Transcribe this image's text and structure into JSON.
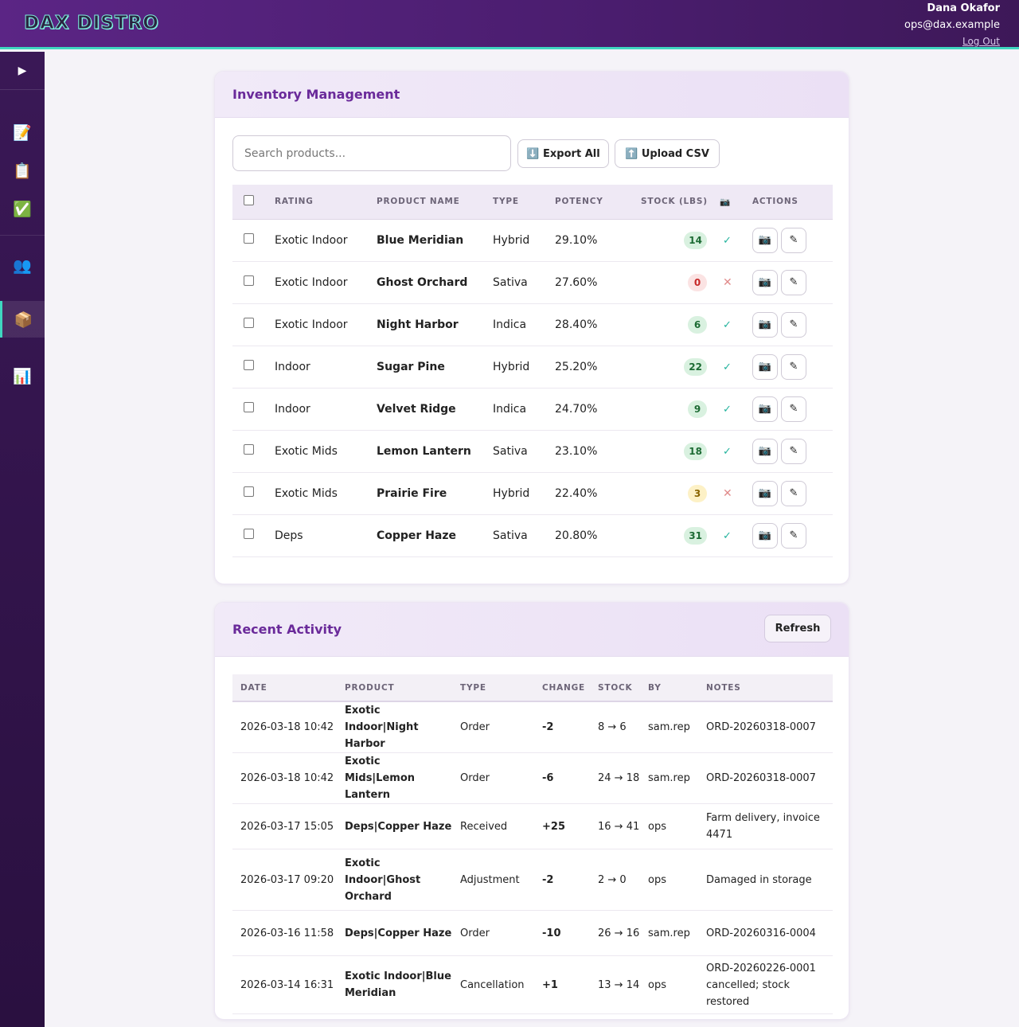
{
  "header": {
    "logo": "DAX DISTRO",
    "user_name": "Dana Okafor",
    "user_email": "ops@dax.example",
    "logout": "Log Out"
  },
  "sidebar": {
    "toggle": "▶",
    "items": [
      {
        "icon": "📝",
        "name": "memo-icon"
      },
      {
        "icon": "📋",
        "name": "clipboard-icon"
      },
      {
        "icon": "✅",
        "name": "checkmark-icon"
      },
      {
        "icon": "👥",
        "name": "users-icon"
      },
      {
        "icon": "📦",
        "name": "package-icon"
      },
      {
        "icon": "📊",
        "name": "chart-icon"
      }
    ]
  },
  "inventory": {
    "title": "Inventory Management",
    "search_placeholder": "Search products...",
    "export_label": "⬇️ Export All",
    "upload_label": "⬆️ Upload CSV",
    "columns": [
      "Rating",
      "Product Name",
      "Type",
      "Potency",
      "Stock (lbs)",
      "📷",
      "Actions"
    ],
    "rows": [
      {
        "rating": "Exotic Indoor",
        "name": "Blue Meridian",
        "type": "Hybrid",
        "potency": "29.10%",
        "stock": "14",
        "stock_level": "green",
        "photo": "✓"
      },
      {
        "rating": "Exotic Indoor",
        "name": "Ghost Orchard",
        "type": "Sativa",
        "potency": "27.60%",
        "stock": "0",
        "stock_level": "red",
        "photo": "✕"
      },
      {
        "rating": "Exotic Indoor",
        "name": "Night Harbor",
        "type": "Indica",
        "potency": "28.40%",
        "stock": "6",
        "stock_level": "green",
        "photo": "✓"
      },
      {
        "rating": "Indoor",
        "name": "Sugar Pine",
        "type": "Hybrid",
        "potency": "25.20%",
        "stock": "22",
        "stock_level": "green",
        "photo": "✓"
      },
      {
        "rating": "Indoor",
        "name": "Velvet Ridge",
        "type": "Indica",
        "potency": "24.70%",
        "stock": "9",
        "stock_level": "green",
        "photo": "✓"
      },
      {
        "rating": "Exotic Mids",
        "name": "Lemon Lantern",
        "type": "Sativa",
        "potency": "23.10%",
        "stock": "18",
        "stock_level": "green",
        "photo": "✓"
      },
      {
        "rating": "Exotic Mids",
        "name": "Prairie Fire",
        "type": "Hybrid",
        "potency": "22.40%",
        "stock": "3",
        "stock_level": "amber",
        "photo": "✕"
      },
      {
        "rating": "Deps",
        "name": "Copper Haze",
        "type": "Sativa",
        "potency": "20.80%",
        "stock": "31",
        "stock_level": "green",
        "photo": "✓"
      }
    ],
    "photo_button_icon": "📷",
    "edit_button_icon": "✎"
  },
  "activity": {
    "title": "Recent Activity",
    "refresh_label": "Refresh",
    "columns": [
      "Date",
      "Product",
      "Type",
      "Change",
      "Stock",
      "By",
      "Notes"
    ],
    "rows": [
      {
        "date": "2026-03-18 10:42",
        "product": "Exotic Indoor|Night Harbor",
        "type": "Order",
        "change": "-2",
        "stock": "8 → 6",
        "by": "sam.rep",
        "notes": "ORD-20260318-0007"
      },
      {
        "date": "2026-03-18 10:42",
        "product": "Exotic Mids|Lemon Lantern",
        "type": "Order",
        "change": "-6",
        "stock": "24 → 18",
        "by": "sam.rep",
        "notes": "ORD-20260318-0007"
      },
      {
        "date": "2026-03-17 15:05",
        "product": "Deps|Copper Haze",
        "type": "Received",
        "change": "+25",
        "stock": "16 → 41",
        "by": "ops",
        "notes": "Farm delivery, invoice 4471"
      },
      {
        "date": "2026-03-17 09:20",
        "product": "Exotic Indoor|Ghost Orchard",
        "type": "Adjustment",
        "change": "-2",
        "stock": "2 → 0",
        "by": "ops",
        "notes": "Damaged in storage"
      },
      {
        "date": "2026-03-16 11:58",
        "product": "Deps|Copper Haze",
        "type": "Order",
        "change": "-10",
        "stock": "26 → 16",
        "by": "sam.rep",
        "notes": "ORD-20260316-0004"
      },
      {
        "date": "2026-03-14 16:31",
        "product": "Exotic Indoor|Blue Meridian",
        "type": "Cancellation",
        "change": "+1",
        "stock": "13 → 14",
        "by": "ops",
        "notes": "ORD-20260226-0001 cancelled; stock restored"
      }
    ]
  },
  "colors": {
    "brand": "#5b2585",
    "accent": "#3fd6c0",
    "title": "#6a2a9a"
  }
}
